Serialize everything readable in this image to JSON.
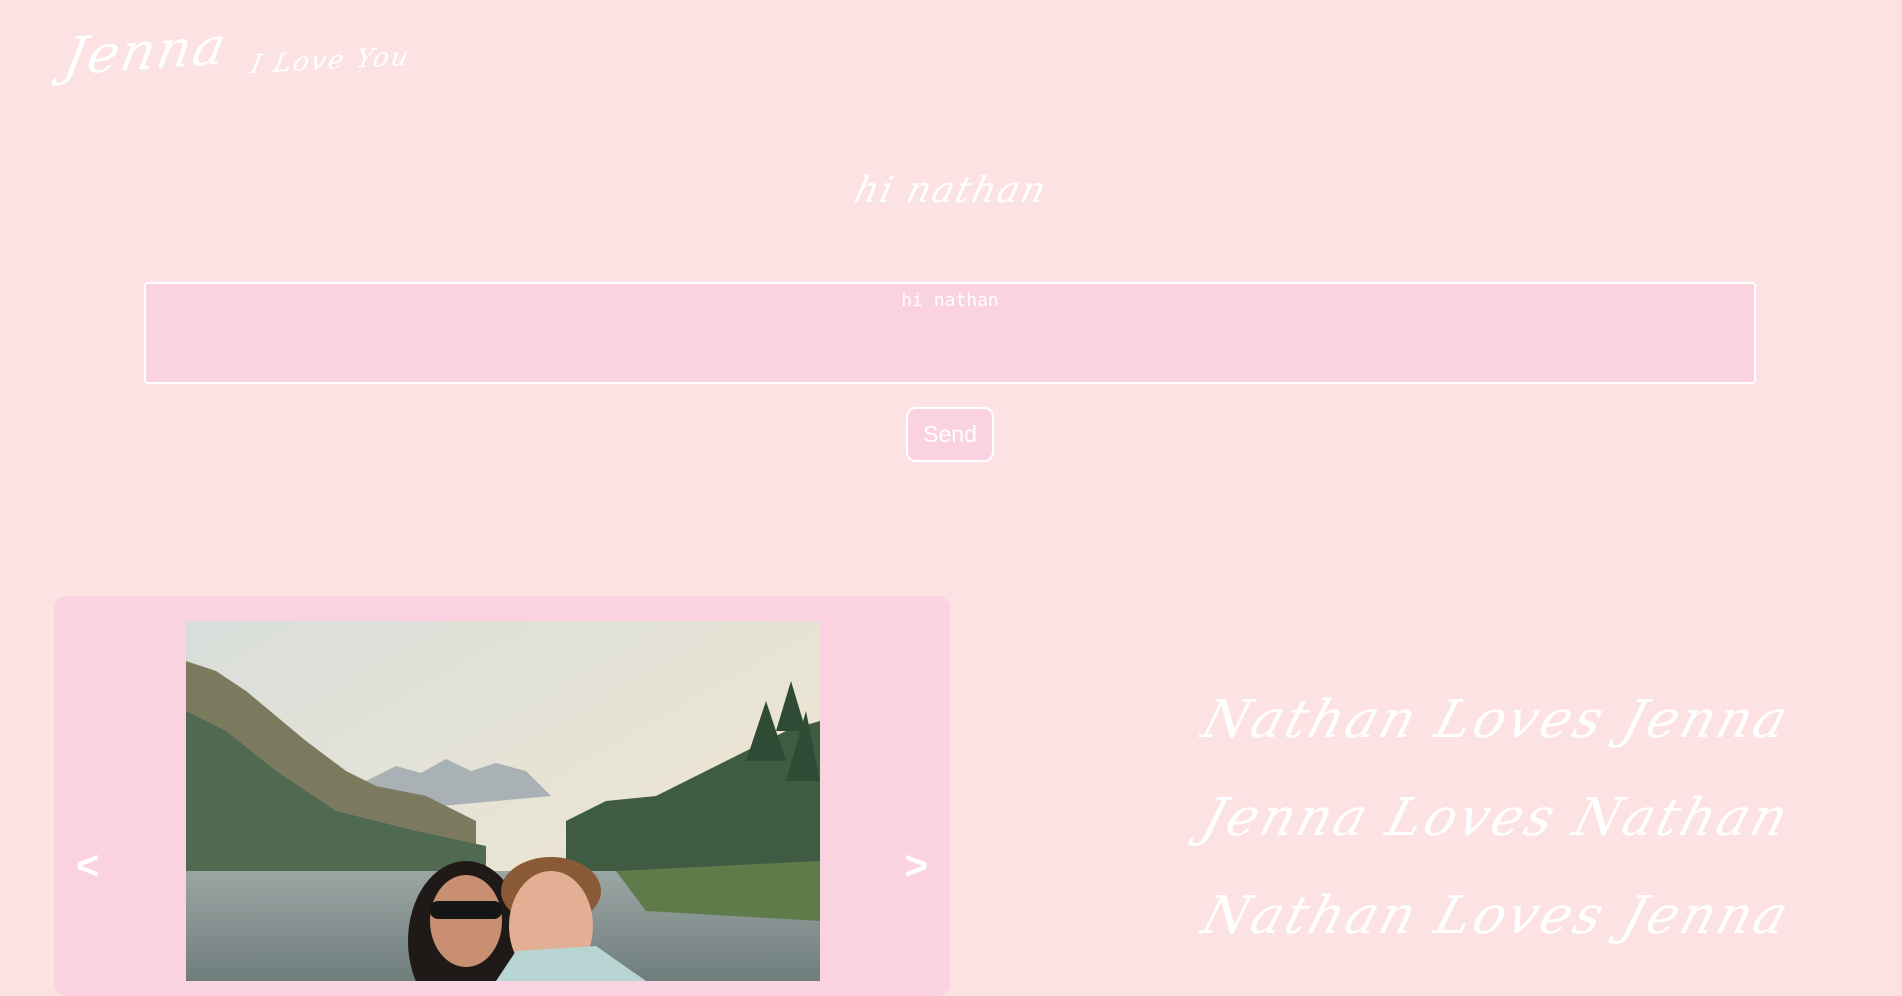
{
  "header": {
    "name": "Jenna",
    "tagline": "I Love You"
  },
  "greeting": "hi nathan",
  "message": {
    "value": "hi nathan"
  },
  "send_button": {
    "label": "Send"
  },
  "carousel": {
    "prev_label": "<",
    "next_label": ">",
    "photo_icon": "couple-photo-icon"
  },
  "taglines": [
    "Nathan Loves Jenna",
    "Jenna Loves Nathan",
    "Nathan Loves Jenna"
  ],
  "colors": {
    "background": "#fde2e4",
    "panel": "#fbd2e0",
    "text": "#ffffff"
  }
}
